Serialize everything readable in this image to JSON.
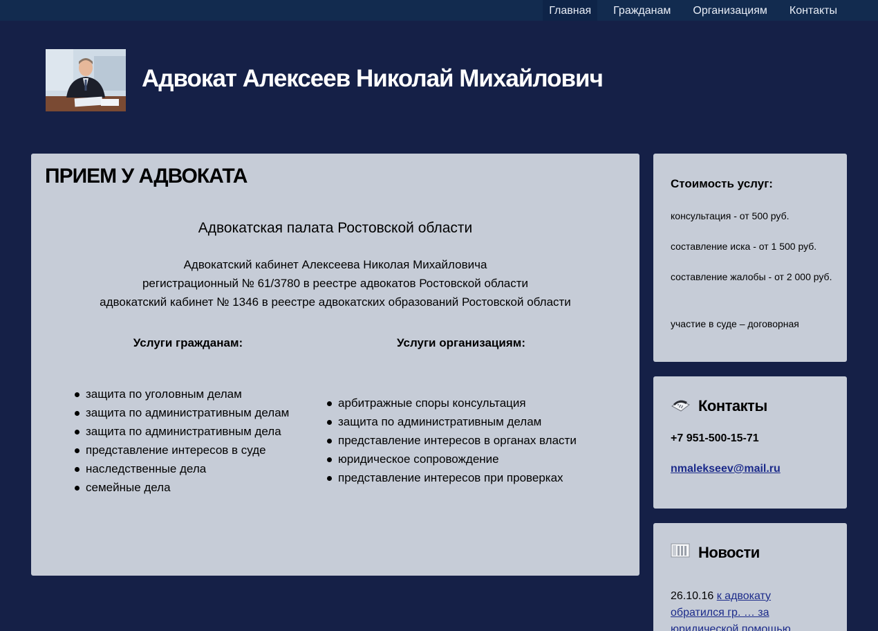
{
  "nav": {
    "items": [
      {
        "label": "Главная",
        "active": true
      },
      {
        "label": "Гражданам",
        "active": false
      },
      {
        "label": "Организациям",
        "active": false
      },
      {
        "label": "Контакты",
        "active": false
      }
    ]
  },
  "header": {
    "title": "Адвокат Алексеев Николай Михайлович",
    "photo_icon": "lawyer-photo"
  },
  "main": {
    "heading": "ПРИЕМ У АДВОКАТА",
    "chamber": "Адвокатская палата Ростовской области",
    "office_lines": [
      "Адвокатский кабинет Алексеева Николая Михайловича",
      "регистрационный № 61/3780 в реестре адвокатов Ростовской области",
      "адвокатский кабинет № 1346 в реестре адвокатских образований Ростовской области"
    ],
    "citizens_heading": "Услуги гражданам:",
    "orgs_heading": "Услуги организациям:",
    "citizens_services": [
      "защита по уголовным делам",
      "защита по административным делам",
      "защита по административным дела",
      "представление интересов в суде",
      "наследственные дела",
      "семейные дела"
    ],
    "orgs_services": [
      "арбитражные споры консультация",
      "защита по административным делам",
      "представление интересов в органах власти",
      "юридическое сопровождение",
      "представление интересов при проверках"
    ]
  },
  "prices": {
    "title": "Стоимость услуг:",
    "items": [
      "консультация - от 500 руб.",
      "составление иска - от 1 500 руб.",
      "составление жалобы - от 2 000 руб.",
      "участие в суде – договорная"
    ]
  },
  "contacts": {
    "title": "Контакты",
    "icon": "telephone-icon",
    "phone": "+7 951-500-15-71",
    "email": "nmalekseev@mail.ru"
  },
  "news": {
    "title": "Новости",
    "icon": "newspaper-icon",
    "date": "26.10.16",
    "link_text": "к адвокату обратился гр. … за юридической помощью"
  },
  "colors": {
    "page_bg": "#152047",
    "topbar_bg": "#122b4f",
    "panel_bg": "#c6ccd7",
    "link": "#1b2a8a"
  }
}
